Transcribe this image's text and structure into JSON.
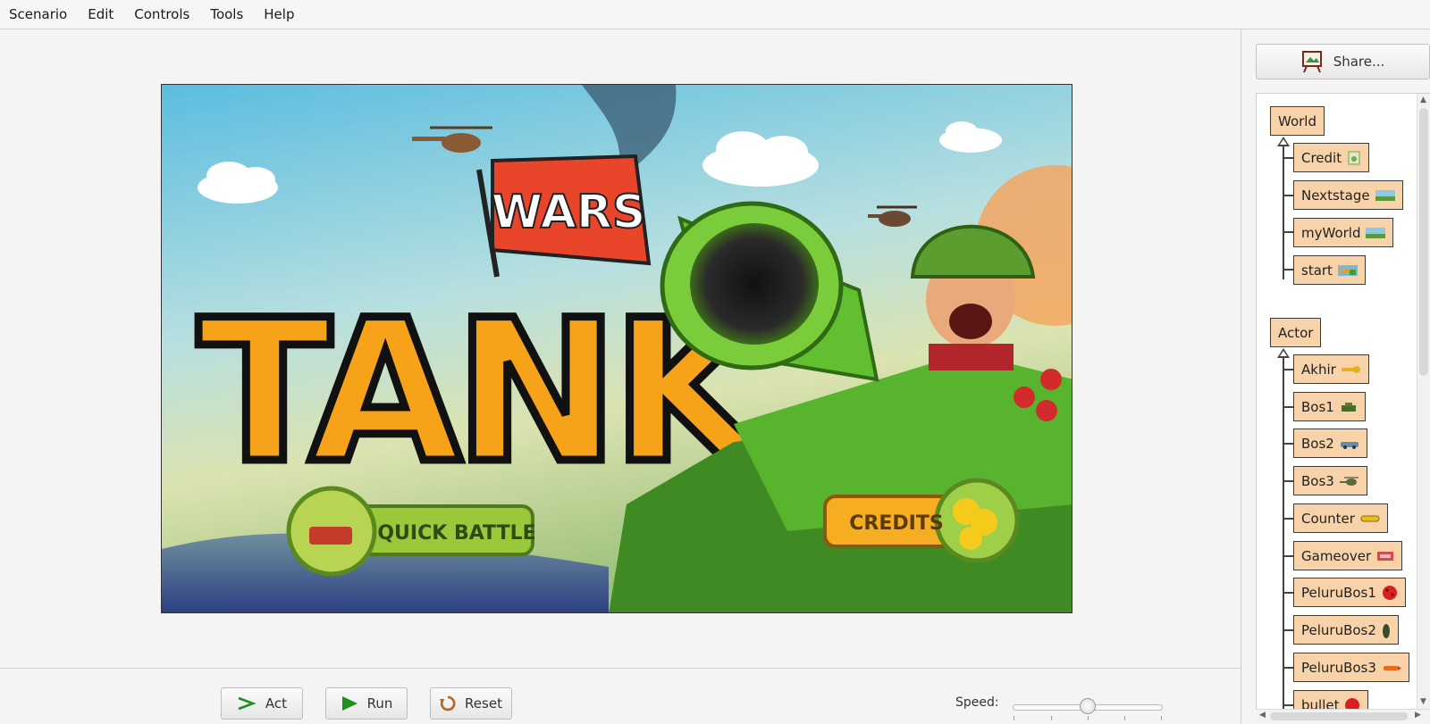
{
  "menu": [
    "Scenario",
    "Edit",
    "Controls",
    "Tools",
    "Help"
  ],
  "game_screen": {
    "logo_flag": "WARS",
    "logo_main": "TANK",
    "quick_battle": "QUICK BATTLE",
    "credits": "CREDITS"
  },
  "controls": {
    "act": "Act",
    "run": "Run",
    "reset": "Reset",
    "speed_label": "Speed:",
    "speed_level": 0.5
  },
  "share": {
    "label": "Share..."
  },
  "world_classes": [
    "World",
    "Credit",
    "Nextstage",
    "myWorld",
    "start"
  ],
  "actor_classes": [
    "Actor",
    "Akhir",
    "Bos1",
    "Bos2",
    "Bos3",
    "Counter",
    "Gameover",
    "PeluruBos1",
    "PeluruBos2",
    "PeluruBos3",
    "bullet"
  ],
  "colors": {
    "class_box": "#f8d2a8",
    "run_icon": "#1f8f1f",
    "reset_icon": "#b5651d"
  }
}
